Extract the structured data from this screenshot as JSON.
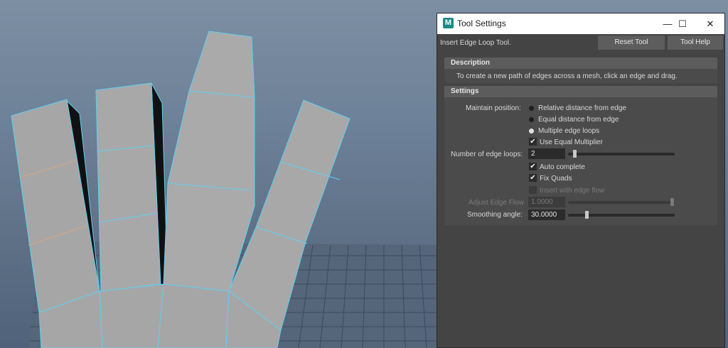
{
  "window": {
    "title": "Tool Settings",
    "app_icon_letter": "M",
    "minimize": "—",
    "maximize": "☐",
    "close": "✕"
  },
  "tool": {
    "name": "Insert Edge Loop Tool.",
    "reset_label": "Reset Tool",
    "help_label": "Tool Help"
  },
  "description": {
    "header": "Description",
    "text": "To create a new path of edges across a mesh, click an edge and drag."
  },
  "settings": {
    "header": "Settings",
    "maintain_position_label": "Maintain position:",
    "maintain_options": [
      {
        "label": "Relative distance from edge",
        "selected": false
      },
      {
        "label": "Equal distance from edge",
        "selected": false
      },
      {
        "label": "Multiple edge loops",
        "selected": true
      }
    ],
    "use_equal_multiplier": {
      "label": "Use Equal Multiplier",
      "checked": true
    },
    "edge_loops": {
      "label": "Number of edge loops:",
      "value": "2",
      "slider_fraction": 0.07
    },
    "auto_complete": {
      "label": "Auto complete",
      "checked": true
    },
    "fix_quads": {
      "label": "Fix Quads",
      "checked": true
    },
    "insert_with_edge_flow": {
      "label": "Insert with edge flow",
      "checked": false,
      "enabled": false
    },
    "adjust_edge_flow": {
      "label": "Adjust Edge Flow",
      "value": "1.0000",
      "slider_fraction": 1.0,
      "enabled": false
    },
    "smoothing_angle": {
      "label": "Smoothing angle:",
      "value": "30.0000",
      "slider_fraction": 0.17
    }
  },
  "colors": {
    "window_bg": "#444444",
    "section_header": "#5c5c5c",
    "wire_highlight": "#5fd0f0",
    "mesh_face": "#a8a8a8"
  }
}
